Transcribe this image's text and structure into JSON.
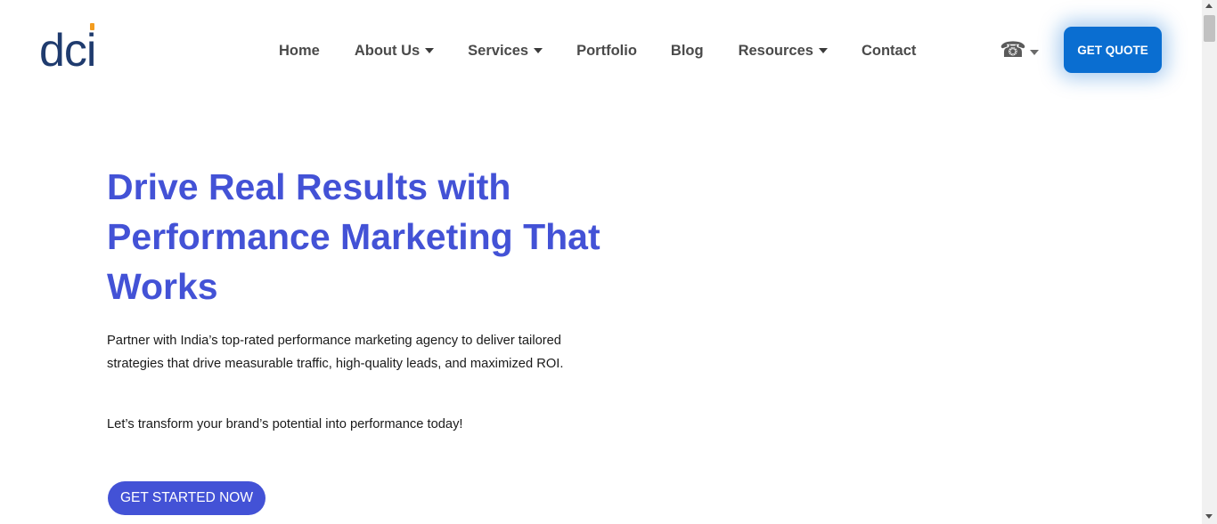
{
  "logo": {
    "text_main": "dc",
    "text_i": "i",
    "dot_color": "#f39c1f",
    "text_color": "#1f3b6e"
  },
  "nav": {
    "items": [
      {
        "label": "Home",
        "has_dropdown": false
      },
      {
        "label": "About Us",
        "has_dropdown": true
      },
      {
        "label": "Services",
        "has_dropdown": true
      },
      {
        "label": "Portfolio",
        "has_dropdown": false
      },
      {
        "label": "Blog",
        "has_dropdown": false
      },
      {
        "label": "Resources",
        "has_dropdown": true
      },
      {
        "label": "Contact",
        "has_dropdown": false
      }
    ]
  },
  "phone": {
    "icon": "phone-icon",
    "glyph": "☎"
  },
  "header_cta": {
    "label": "GET QUOTE",
    "color": "#0a6ed1"
  },
  "hero": {
    "title": "Drive Real Results with Performance Marketing That Works",
    "description": "Partner with India’s top-rated performance marketing agency to deliver tailored strategies that drive measurable traffic, high-quality leads, and maximized ROI.",
    "tagline": "Let’s transform your brand’s potential into performance today!",
    "cta_label": "GET STARTED NOW",
    "accent_color": "#4352d6"
  }
}
